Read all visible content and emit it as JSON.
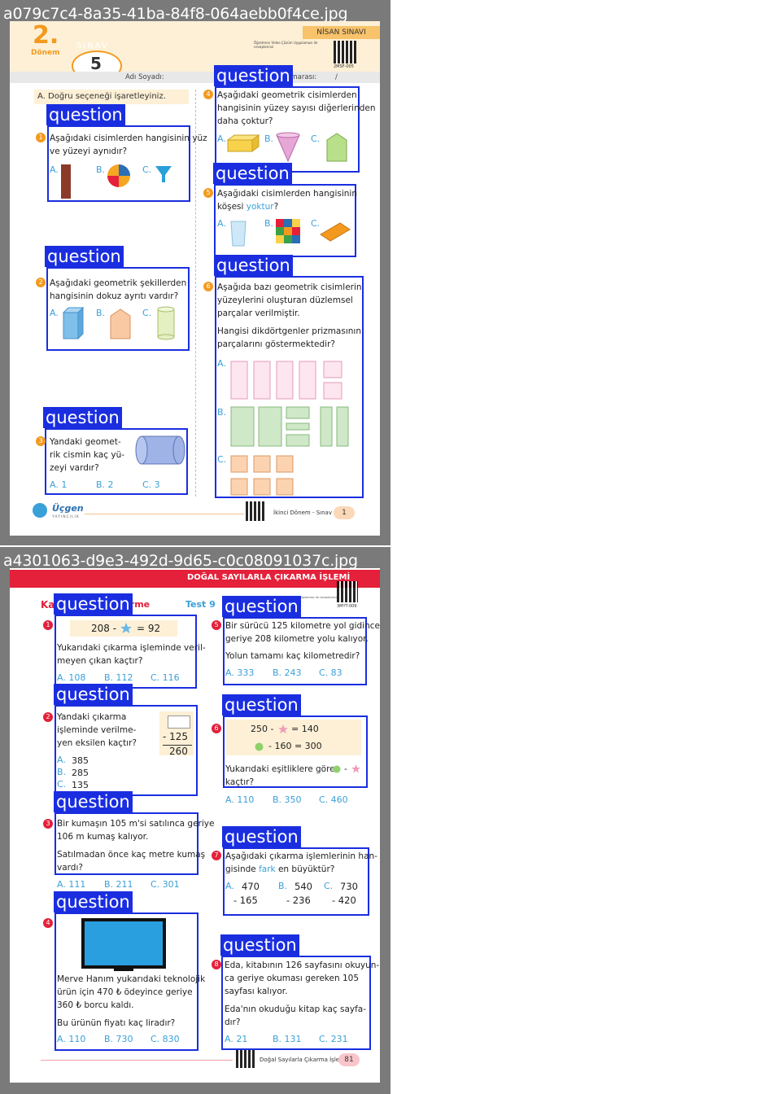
{
  "page1": {
    "filename": "a079c7c4-8a35-41ba-84f8-064aebb0f4ce.jpg",
    "header": {
      "term_number": "2.",
      "term_word": "Dönem",
      "exam_word": "SINAV",
      "exam_number": "5",
      "exam_name": "NİSAN SINAVI",
      "qr_note": "Öğretmen Video Çözüm Uygulaması ile cevaplarınız",
      "qr_code": "2MSF-005",
      "name_label": "Adı Soyadı:",
      "number_label": "umarası:",
      "slash": "/"
    },
    "instruction": "A. Doğru seçeneği işaretleyiniz.",
    "question_label": "question",
    "q1": {
      "n": "1",
      "text": [
        "Aşağıdaki cisimlerden hangisinin yüz",
        "ve yüzeyi aynıdır?"
      ],
      "a": "A.",
      "b": "B.",
      "c": "C."
    },
    "q2": {
      "n": "2",
      "text": [
        "Aşağıdaki geometrik şekillerden",
        "hangisinin dokuz ayrıtı vardır?"
      ],
      "a": "A.",
      "b": "B.",
      "c": "C."
    },
    "q3": {
      "n": "3",
      "text": [
        "Yandaki geomet-",
        "rik cismin kaç yü-",
        "zeyi vardır?"
      ],
      "a": "A. 1",
      "b": "B. 2",
      "c": "C. 3"
    },
    "q4": {
      "n": "4",
      "text": [
        "Aşağıdaki geometrik cisimlerden",
        "hangisinin yüzey sayısı diğerlerinden",
        "daha çoktur?"
      ],
      "a": "A.",
      "b": "B.",
      "c": "C."
    },
    "q5": {
      "n": "5",
      "text1": "Aşağıdaki cisimlerden hangisinin",
      "text2a": "köşesi ",
      "text2b": "yoktur",
      "text2c": "?",
      "a": "A.",
      "b": "B.",
      "c": "C."
    },
    "q6": {
      "n": "6",
      "text": [
        "Aşağıda bazı geometrik cisimlerin",
        "yüzeylerini oluşturan düzlemsel",
        "parçalar verilmiştir."
      ],
      "text2": [
        "Hangisi dikdörtgenler prizmasının",
        "parçalarını göstermektedir?"
      ],
      "a": "A.",
      "b": "B.",
      "c": "C."
    },
    "footer": {
      "brand": "Üçgen",
      "brand_sub": "YAYINCILIK",
      "label": "İkinci Dönem - Sınav 5",
      "page": "1"
    }
  },
  "page2": {
    "filename": "a4301063-d9e3-492d-9d65-c0c08091037c.jpg",
    "header": {
      "title": "DOĞAL SAYILARLA ÇIKARMA İŞLEMİ",
      "qr_code": "3MYT-009",
      "qr_note": "Video Çözüm Uygulaması ile cevaplarınız",
      "section_prefix": "Ka",
      "section_suffix": "irme",
      "test": "Test 9"
    },
    "question_label": "question",
    "q1": {
      "n": "1",
      "eq_left": "208 -",
      "eq_right": "= 92",
      "text": [
        "Yukarıdaki çıkarma işleminde veril-",
        "meyen çıkan kaçtır?"
      ],
      "a": "A. 108",
      "b": "B. 112",
      "c": "C. 116"
    },
    "q2": {
      "n": "2",
      "text": [
        "Yandaki çıkarma",
        "işleminde verilme-",
        "yen eksilen kaçtır?"
      ],
      "sub": "- 125",
      "result": "260",
      "a": "A.",
      "a_val": "385",
      "b": "B.",
      "b_val": "285",
      "c": "C.",
      "c_val": "135"
    },
    "q3": {
      "n": "3",
      "text": [
        "Bir kumaşın 105 m'si satılınca geriye",
        "106 m kumaş kalıyor."
      ],
      "text2": [
        "Satılmadan önce kaç metre kumaş",
        "vardı?"
      ],
      "a": "A. 111",
      "b": "B. 211",
      "c": "C. 301"
    },
    "q4": {
      "n": "4",
      "text": [
        "Merve Hanım yukarıdaki teknolojik",
        "ürün için 470 ₺ ödeyince geriye",
        "360 ₺ borcu kaldı."
      ],
      "text2": "Bu ürünün fiyatı kaç liradır?",
      "a": "A. 110",
      "b": "B. 730",
      "c": "C. 830"
    },
    "q5": {
      "n": "5",
      "text": [
        "Bir sürücü 125 kilometre yol gidince",
        "geriye 208 kilometre yolu kalıyor."
      ],
      "text2": "Yolun tamamı kaç kilometredir?",
      "a": "A. 333",
      "b": "B. 243",
      "c": "C. 83"
    },
    "q6": {
      "n": "6",
      "eq1_left": "250 -",
      "eq1_right": "= 140",
      "eq2": "- 160 = 300",
      "text": "Yukarıdaki eşitliklere göre",
      "text_tail": "-",
      "text2": "kaçtır?",
      "a": "A. 110",
      "b": "B. 350",
      "c": "C. 460"
    },
    "q7": {
      "n": "7",
      "text1": "Aşağıdaki çıkarma işlemlerinin han-",
      "text2a": "gisinde ",
      "text2b": "fark",
      "text2c": " en büyüktür?",
      "a": "A.",
      "a1": "470",
      "a2": "- 165",
      "b": "B.",
      "b1": "540",
      "b2": "- 236",
      "c": "C.",
      "c1": "730",
      "c2": "- 420"
    },
    "q8": {
      "n": "8",
      "text": [
        "Eda, kitabının 126 sayfasını okuyun-",
        "ca geriye okuması gereken 105",
        "sayfası kalıyor."
      ],
      "text2": [
        "Eda'nın okuduğu kitap kaç sayfa-",
        "dır?"
      ],
      "a": "A. 21",
      "b": "B. 131",
      "c": "C. 231"
    },
    "footer": {
      "label": "Doğal Sayılarla Çıkarma İşlemi",
      "page": "81"
    }
  },
  "colors": {
    "box": "#1a2ee0",
    "orange": "#f39a1e",
    "red": "#e4203a",
    "option": "#3aa0d8"
  }
}
